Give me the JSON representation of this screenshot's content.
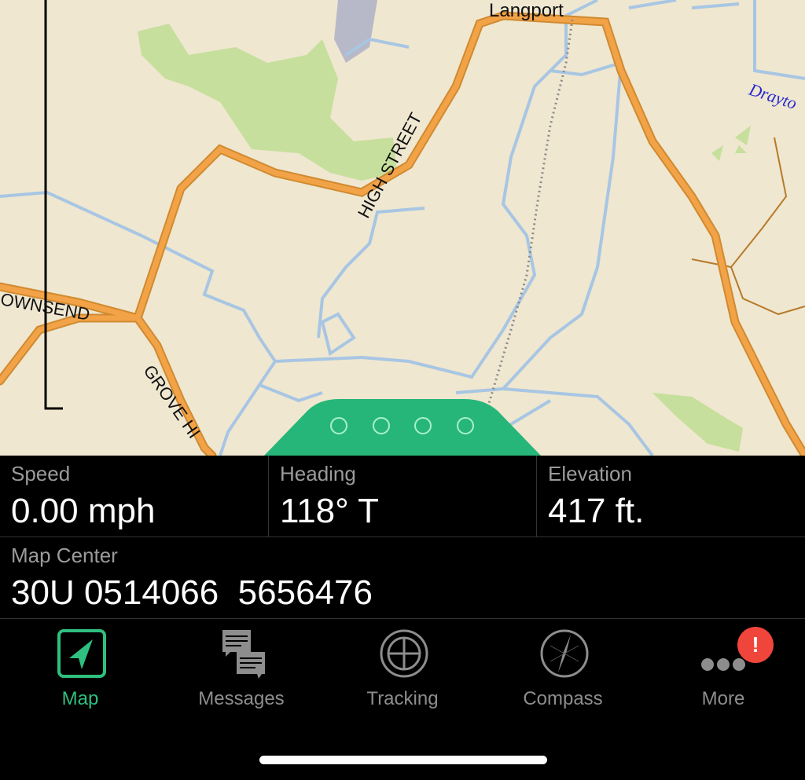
{
  "map": {
    "labels": {
      "langport": "Langport",
      "high_street": "HIGH STREET",
      "townsend": "OWNSEND",
      "grove_hill": "GROVE HI",
      "drayton": "Drayto"
    },
    "colors": {
      "land": "#efe7d0",
      "road": "#f3a347",
      "water": "#a8c6e3",
      "green": "#c6df9c"
    }
  },
  "drawer": {
    "page_indicators": 4,
    "color": "#27b679"
  },
  "readouts": {
    "speed": {
      "label": "Speed",
      "value": "0.00 mph"
    },
    "heading": {
      "label": "Heading",
      "value": "118° T"
    },
    "elevation": {
      "label": "Elevation",
      "value": "417 ft."
    },
    "map_center": {
      "label": "Map Center",
      "value": "30U 0514066  5656476"
    }
  },
  "tabs": [
    {
      "label": "Map",
      "icon": "navigation-arrow-icon",
      "active": true
    },
    {
      "label": "Messages",
      "icon": "messages-icon",
      "active": false
    },
    {
      "label": "Tracking",
      "icon": "crosshair-icon",
      "active": false
    },
    {
      "label": "Compass",
      "icon": "compass-icon",
      "active": false
    },
    {
      "label": "More",
      "icon": "more-dots-icon",
      "active": false
    }
  ],
  "more_badge": "!",
  "accent": "#2fbf7f"
}
